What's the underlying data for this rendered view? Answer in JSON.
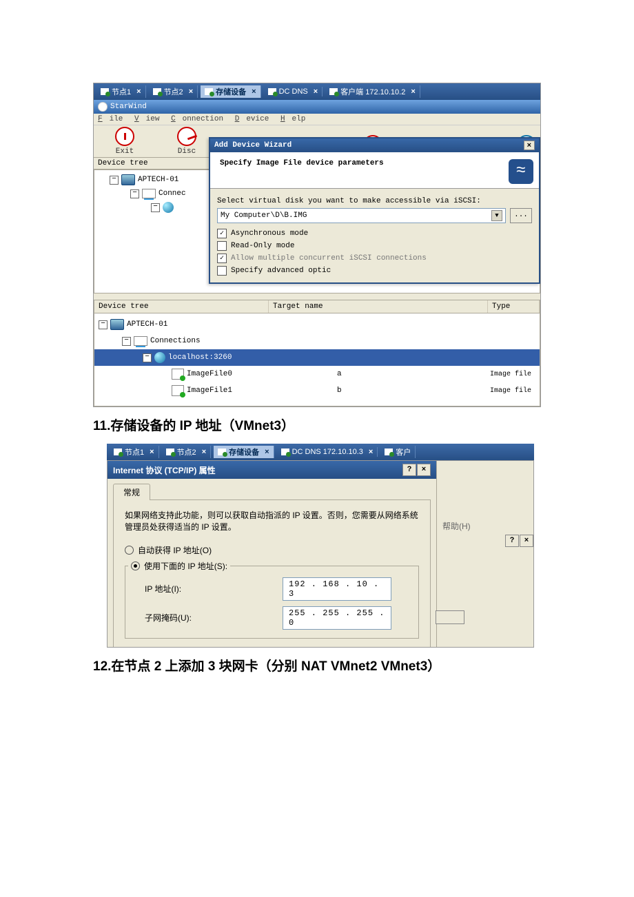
{
  "shot1": {
    "tabs": [
      {
        "label": "节点1",
        "active": false
      },
      {
        "label": "节点2",
        "active": false
      },
      {
        "label": "存储设备",
        "active": true
      },
      {
        "label": "DC  DNS",
        "active": false
      },
      {
        "label": "客户端 172.10.10.2",
        "active": false
      }
    ],
    "window_title": "StarWind",
    "menubar": {
      "file": "File",
      "view": "View",
      "connection": "Connection",
      "device": "Device",
      "help": "Help"
    },
    "toolbar": {
      "exit": "Exit",
      "disc": "Disc"
    },
    "device_tree_header": "Device tree",
    "tree": {
      "root": "APTECH-01",
      "conn": "Connec"
    },
    "wizard": {
      "title": "Add Device Wizard",
      "heading": "Specify Image File device parameters",
      "prompt": "Select virtual disk you want to make accessible via iSCSI:",
      "combo_value": "My Computer\\D\\B.IMG",
      "browse": "...",
      "opt_async": "Asynchronous mode",
      "opt_readonly": "Read-Only mode",
      "opt_multi": "Allow multiple concurrent iSCSI connections",
      "opt_adv": "Specify advanced optic"
    },
    "grid": {
      "col1": "Device tree",
      "col2": "Target name",
      "col3": "Type",
      "rows": {
        "root": "APTECH-01",
        "conn": "Connections",
        "host": "localhost:3260",
        "f0": "ImageFile0",
        "f0_t": "a",
        "f0_ty": "Image file",
        "f1": "ImageFile1",
        "f1_t": "b",
        "f1_ty": "Image file"
      }
    }
  },
  "heading11": "11.存储设备的 IP 地址（VMnet3）",
  "shot2": {
    "tabs": [
      {
        "label": "节点1",
        "active": false
      },
      {
        "label": "节点2",
        "active": false
      },
      {
        "label": "存储设备",
        "active": true
      },
      {
        "label": "DC DNS 172.10.10.3",
        "active": false
      },
      {
        "label": "客户",
        "active": false
      }
    ],
    "dlg_title": "Internet 协议 (TCP/IP) 属性",
    "tab_general": "常规",
    "desc": "如果网络支持此功能，则可以获取自动指派的 IP 设置。否则，您需要从网络系统管理员处获得适当的 IP 设置。",
    "radio_auto": "自动获得 IP 地址(O)",
    "radio_use": "使用下面的 IP 地址(S):",
    "ip_label": "IP 地址(I):",
    "ip_value": "192 . 168 .  10  .  3",
    "mask_label": "子网掩码(U):",
    "mask_value": "255 . 255 . 255 .  0",
    "help_link": "帮助(H)"
  },
  "heading12": "12.在节点 2 上添加 3 块网卡（分别 NAT VMnet2 VMnet3）"
}
